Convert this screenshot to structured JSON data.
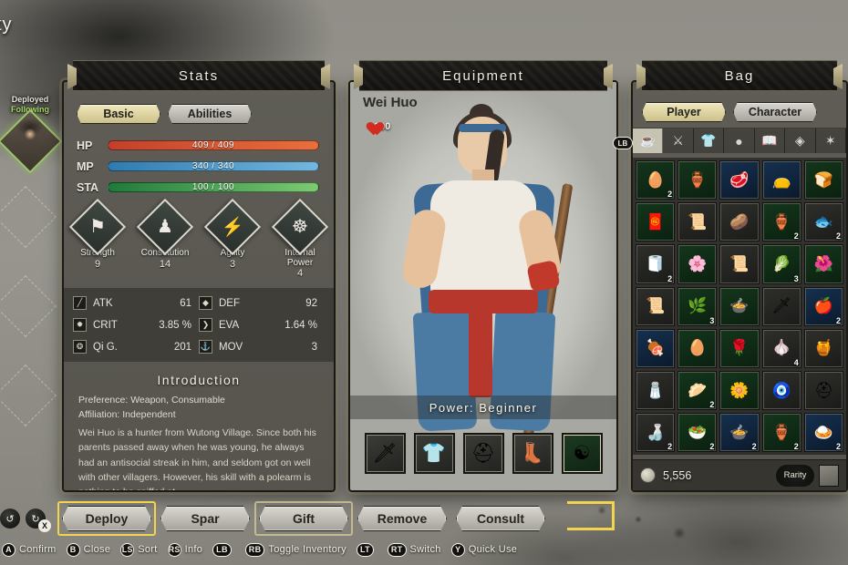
{
  "screen": {
    "party_title": "ty"
  },
  "party_rail": {
    "tag_deployed": "Deployed",
    "tag_following": "Following"
  },
  "stats": {
    "title": "Stats",
    "tabs": [
      {
        "label": "Basic",
        "active": true
      },
      {
        "label": "Abilities",
        "active": false
      }
    ],
    "bars": [
      {
        "label": "HP",
        "text": "409 / 409",
        "current": 409,
        "max": 409,
        "color": "#e8703d"
      },
      {
        "label": "MP",
        "text": "340 / 340",
        "current": 340,
        "max": 340,
        "color": "#74b7de"
      },
      {
        "label": "STA",
        "text": "100 / 100",
        "current": 100,
        "max": 100,
        "color": "#7dcb72"
      }
    ],
    "attributes": [
      {
        "name": "Strength",
        "value": "9",
        "icon": "strength-icon",
        "glyph": "⚑"
      },
      {
        "name": "Constitution",
        "value": "14",
        "icon": "constitution-icon",
        "glyph": "♟"
      },
      {
        "name": "Agility",
        "value": "3",
        "icon": "agility-icon",
        "glyph": "⚡"
      },
      {
        "name": "Internal Power",
        "value": "4",
        "icon": "internal-power-icon",
        "glyph": "☸"
      }
    ],
    "substats": [
      {
        "key": "ATK",
        "value": "61",
        "icon": "sword-icon",
        "glyph": "╱"
      },
      {
        "key": "DEF",
        "value": "92",
        "icon": "shield-icon",
        "glyph": "◆"
      },
      {
        "key": "CRIT",
        "value": "3.85 %",
        "icon": "crit-icon",
        "glyph": "✹"
      },
      {
        "key": "EVA",
        "value": "1.64 %",
        "icon": "eva-icon",
        "glyph": "❯"
      },
      {
        "key": "Qi G.",
        "value": "201",
        "icon": "qi-icon",
        "glyph": "❂"
      },
      {
        "key": "MOV",
        "value": "3",
        "icon": "mov-icon",
        "glyph": "⚓"
      }
    ],
    "introduction": {
      "title": "Introduction",
      "preference": "Preference:  Weapon, Consumable",
      "affiliation": "Affiliation: Independent",
      "body": "Wei Huo is a hunter from Wutong Village. Since both his parents passed away when he was young, he always had an antisocial streak in him, and seldom got on well with other villagers. However, his skill with a polearm is nothing to be sniffed at."
    }
  },
  "equipment": {
    "title": "Equipment",
    "character_name": "Wei Huo",
    "favor_value": "100",
    "power_label": "Power: Beginner",
    "slots": [
      {
        "name": "weapon-slot",
        "glyph": "🗡",
        "selected": false
      },
      {
        "name": "armor-slot",
        "glyph": "👕",
        "selected": false
      },
      {
        "name": "helmet-slot",
        "glyph": "⛑",
        "selected": false
      },
      {
        "name": "boots-slot",
        "glyph": "👢",
        "selected": false
      },
      {
        "name": "accessory-slot",
        "glyph": "☯",
        "selected": true
      }
    ]
  },
  "bag": {
    "title": "Bag",
    "lb_hint": "LB",
    "tabs": [
      {
        "label": "Player",
        "active": true
      },
      {
        "label": "Character",
        "active": false
      }
    ],
    "categories": [
      {
        "name": "consumables-category",
        "glyph": "☕",
        "active": true
      },
      {
        "name": "weapons-category",
        "glyph": "⚔",
        "active": false
      },
      {
        "name": "armor-category",
        "glyph": "👕",
        "active": false
      },
      {
        "name": "accessory-category",
        "glyph": "●",
        "active": false
      },
      {
        "name": "books-category",
        "glyph": "📖",
        "active": false
      },
      {
        "name": "materials-category",
        "glyph": "◈",
        "active": false
      },
      {
        "name": "misc-category",
        "glyph": "✶",
        "active": false
      }
    ],
    "items": [
      {
        "glyph": "🥚",
        "qty": "2",
        "bg": "g"
      },
      {
        "glyph": "🏺",
        "qty": "",
        "bg": "g"
      },
      {
        "glyph": "🥩",
        "qty": "",
        "bg": "b"
      },
      {
        "glyph": "👝",
        "qty": "",
        "bg": "b"
      },
      {
        "glyph": "🍞",
        "qty": "",
        "bg": "g"
      },
      {
        "glyph": "🧧",
        "qty": "",
        "bg": "g"
      },
      {
        "glyph": "📜",
        "qty": "",
        "bg": ""
      },
      {
        "glyph": "🥔",
        "qty": "",
        "bg": ""
      },
      {
        "glyph": "🏺",
        "qty": "2",
        "bg": "g"
      },
      {
        "glyph": "🐟",
        "qty": "2",
        "bg": ""
      },
      {
        "glyph": "🧻",
        "qty": "2",
        "bg": ""
      },
      {
        "glyph": "🌸",
        "qty": "",
        "bg": "g"
      },
      {
        "glyph": "📜",
        "qty": "",
        "bg": ""
      },
      {
        "glyph": "🥬",
        "qty": "3",
        "bg": "g"
      },
      {
        "glyph": "🌺",
        "qty": "",
        "bg": "g"
      },
      {
        "glyph": "📜",
        "qty": "",
        "bg": ""
      },
      {
        "glyph": "🌿",
        "qty": "3",
        "bg": "g"
      },
      {
        "glyph": "🍲",
        "qty": "",
        "bg": "g"
      },
      {
        "glyph": "🗡",
        "qty": "",
        "bg": ""
      },
      {
        "glyph": "🍎",
        "qty": "2",
        "bg": "b"
      },
      {
        "glyph": "🍖",
        "qty": "",
        "bg": "b"
      },
      {
        "glyph": "🥚",
        "qty": "",
        "bg": "g"
      },
      {
        "glyph": "🌹",
        "qty": "",
        "bg": "g"
      },
      {
        "glyph": "🧄",
        "qty": "4",
        "bg": ""
      },
      {
        "glyph": "🍯",
        "qty": "",
        "bg": ""
      },
      {
        "glyph": "🧂",
        "qty": "",
        "bg": ""
      },
      {
        "glyph": "🥟",
        "qty": "2",
        "bg": "g"
      },
      {
        "glyph": "🌼",
        "qty": "",
        "bg": "g"
      },
      {
        "glyph": "🧿",
        "qty": "",
        "bg": ""
      },
      {
        "glyph": "⛑",
        "qty": "",
        "bg": ""
      },
      {
        "glyph": "🍶",
        "qty": "2",
        "bg": ""
      },
      {
        "glyph": "🥗",
        "qty": "2",
        "bg": "g"
      },
      {
        "glyph": "🍲",
        "qty": "2",
        "bg": "b"
      },
      {
        "glyph": "🏺",
        "qty": "2",
        "bg": "g"
      },
      {
        "glyph": "🍛",
        "qty": "2",
        "bg": "b"
      }
    ],
    "currency": "5,556",
    "rarity_label": "Rarity"
  },
  "actions": [
    {
      "label": "Deploy",
      "focus": "primary"
    },
    {
      "label": "Spar",
      "focus": ""
    },
    {
      "label": "Gift",
      "focus": "secondary"
    },
    {
      "label": "Remove",
      "focus": ""
    },
    {
      "label": "Consult",
      "focus": ""
    }
  ],
  "hints": [
    {
      "pad": "A",
      "round": true,
      "label": "Confirm"
    },
    {
      "pad": "B",
      "round": true,
      "label": "Close"
    },
    {
      "pad": "LS",
      "round": true,
      "label": "Sort"
    },
    {
      "pad": "RS",
      "round": true,
      "label": "Info"
    },
    {
      "pad": "LB",
      "round": false,
      "label": ""
    },
    {
      "pad": "RB",
      "round": false,
      "label": "Toggle Inventory"
    },
    {
      "pad": "LT",
      "round": false,
      "label": ""
    },
    {
      "pad": "RT",
      "round": false,
      "label": "Switch"
    },
    {
      "pad": "Y",
      "round": true,
      "label": "Quick Use"
    }
  ]
}
